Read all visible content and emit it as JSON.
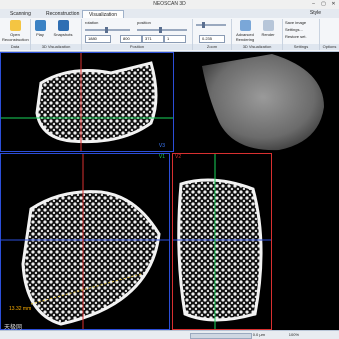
{
  "window": {
    "title": "NEOSCAN 3D",
    "minimize": "–",
    "maximize": "▢",
    "close": "✕"
  },
  "tabs": [
    {
      "label": "Scanning"
    },
    {
      "label": "Reconstruction"
    },
    {
      "label": "Visualization"
    }
  ],
  "tabs_right": "Style",
  "ribbon": {
    "groups": [
      "Data",
      "3D Visualization",
      "Position",
      "Zoom",
      "3D Visualization",
      "Settings",
      "Options"
    ],
    "buttons": {
      "open": "Open Reconstruction",
      "play": "Play",
      "snap": "Snapshots",
      "advanced": "Advanced Rendering",
      "render": "Render",
      "save_image": "Save image",
      "settings": "Settings...",
      "restore": "Restore set."
    },
    "spins": {
      "zoom": "1880",
      "pos_x": "800",
      "pos_y": "371",
      "pos_z": "1"
    },
    "spin_labels": {
      "rotation": "rotation",
      "position": "position"
    },
    "zoom_value": "0.235"
  },
  "views": {
    "v3_label": "V3",
    "v1_label": "V1",
    "v2_label": "V2",
    "measure": "13.32 mm"
  },
  "status": {
    "text": "0.0 μm",
    "zoom": "100%"
  },
  "watermark": "天极网"
}
